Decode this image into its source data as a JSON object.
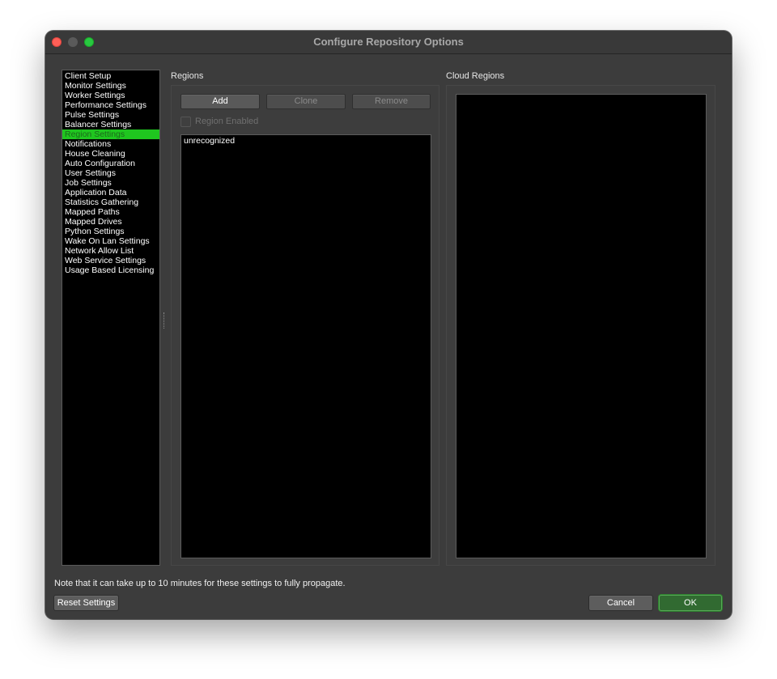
{
  "window": {
    "title": "Configure Repository Options"
  },
  "nav": {
    "selected": "Region Settings",
    "items": [
      "Client Setup",
      "Monitor Settings",
      "Worker Settings",
      "Performance Settings",
      "Pulse Settings",
      "Balancer Settings",
      "Region Settings",
      "Notifications",
      "House Cleaning",
      "Auto Configuration",
      "User Settings",
      "Job Settings",
      "Application Data",
      "Statistics Gathering",
      "Mapped Paths",
      "Mapped Drives",
      "Python Settings",
      "Wake On Lan Settings",
      "Network Allow List",
      "Web Service Settings",
      "Usage Based Licensing"
    ]
  },
  "regions": {
    "label": "Regions",
    "add_label": "Add",
    "clone_label": "Clone",
    "remove_label": "Remove",
    "enabled_label": "Region Enabled",
    "enabled_checked": false,
    "items": [
      "unrecognized"
    ]
  },
  "cloud_regions": {
    "label": "Cloud Regions",
    "items": []
  },
  "footer": {
    "note": "Note that it can take up to 10 minutes for these settings to fully propagate.",
    "reset_label": "Reset Settings",
    "cancel_label": "Cancel",
    "ok_label": "OK"
  },
  "colors": {
    "selection": "#1fc61f",
    "window_bg": "#3c3c3c",
    "list_bg": "#000000"
  }
}
